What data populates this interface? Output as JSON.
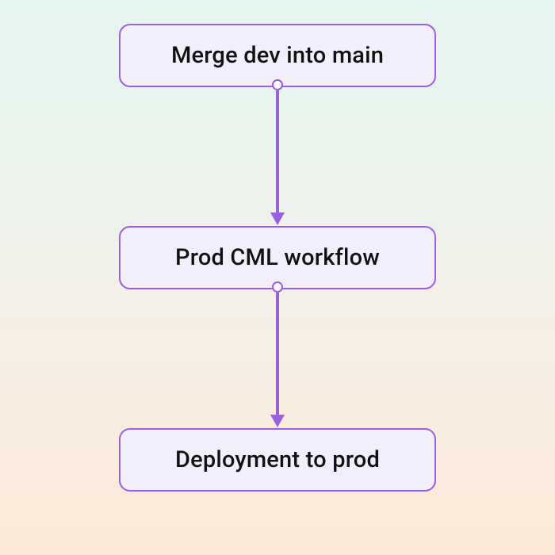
{
  "diagram": {
    "type": "flowchart",
    "direction": "top-to-bottom",
    "nodes": [
      {
        "id": "merge",
        "label": "Merge dev into main"
      },
      {
        "id": "cml",
        "label": "Prod CML workflow"
      },
      {
        "id": "deploy",
        "label": "Deployment to prod"
      }
    ],
    "edges": [
      {
        "from": "merge",
        "to": "cml"
      },
      {
        "from": "cml",
        "to": "deploy"
      }
    ],
    "colors": {
      "node_fill": "#f3eefc",
      "node_border": "#9a5ee0",
      "arrow": "#9a5ee0",
      "text": "#111111"
    }
  }
}
